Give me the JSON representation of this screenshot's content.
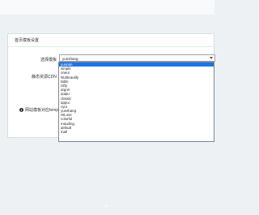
{
  "panel": {
    "title": "首页模板设置"
  },
  "form": {
    "template_label": "选择模板",
    "template_value": "yunshang",
    "static_label": "静态资源CDN"
  },
  "info": {
    "text": "网站模板对应templ"
  },
  "dropdown": {
    "options": [
      "yunnan",
      "simple",
      "oneui",
      "NUBeautify",
      "table",
      "nifty",
      "argon",
      "quqiu",
      "classic",
      "appui",
      "cyui",
      "yunshang",
      "HiLove",
      "colorful",
      "maoding",
      "default",
      "mall"
    ],
    "selected_index": 0
  }
}
